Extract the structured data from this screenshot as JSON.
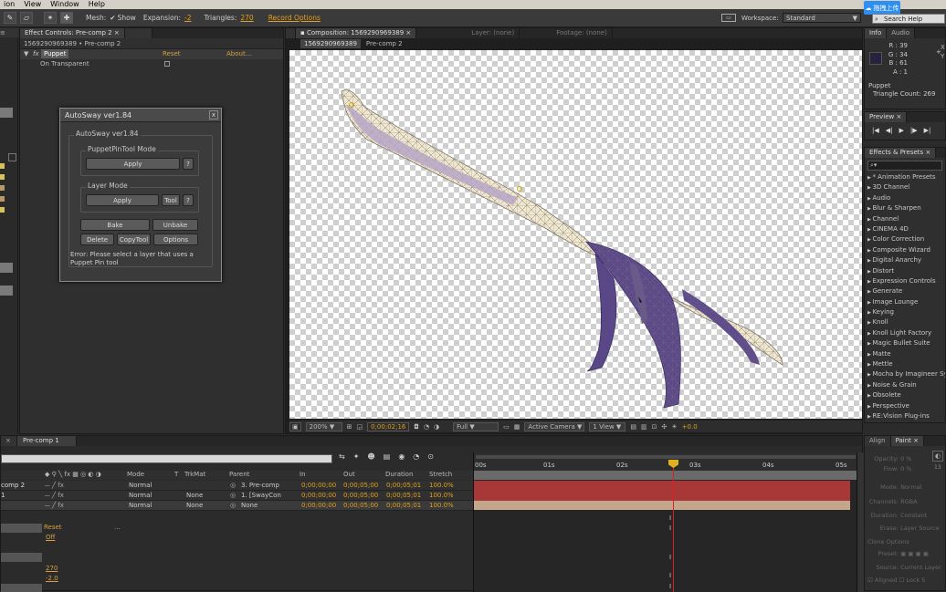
{
  "menubar": {
    "items": [
      "ion",
      "View",
      "Window",
      "Help"
    ]
  },
  "toolbar": {
    "mesh_label": "Mesh:",
    "show_label": "Show",
    "expansion_label": "Expansion:",
    "expansion_value": "-2",
    "triangles_label": "Triangles:",
    "triangles_value": "270",
    "record_options": "Record Options",
    "workspace_label": "Workspace:",
    "workspace_value": "Standard",
    "search_help": "Search Help",
    "cloud_label": "拖拽上传"
  },
  "effect_controls": {
    "tab": "Effect Controls: Pre-comp 2",
    "breadcrumb": "1569290969389 • Pre-comp 2",
    "effect_name": "Puppet",
    "reset": "Reset",
    "about": "About...",
    "on_transparent": "On Transparent"
  },
  "autosway": {
    "title": "AutoSway ver1.84",
    "group_label": "AutoSway ver1.84",
    "puppet_mode": "PuppetPinTool Mode",
    "apply": "Apply",
    "help": "?",
    "layer_mode": "Layer Mode",
    "layer_apply": "Apply",
    "tool": "Tool",
    "layer_help": "?",
    "bake": "Bake",
    "unbake": "Unbake",
    "delete": "Delete",
    "copytool": "CopyTool",
    "options": "Options",
    "error": "Error: Please select a layer that uses a Puppet Pin tool"
  },
  "composition": {
    "tab": "Composition: 1569290969389",
    "layer_tab": "Layer: (none)",
    "footage_tab": "Footage: (none)",
    "sub_tab1": "1569290969389",
    "sub_tab2": "Pre-comp 2"
  },
  "viewer_footer": {
    "zoom": "200%",
    "timecode": "0;00;02;16",
    "resolution": "Full",
    "camera": "Active Camera",
    "view": "1 View",
    "exposure": "+0.0"
  },
  "info": {
    "tab_info": "Info",
    "tab_audio": "Audio",
    "r": "R : 39",
    "g": "G : 34",
    "b": "B : 61",
    "a": "A : 1",
    "x": "X",
    "y": "Y",
    "layer": "Puppet",
    "triangle_count": "Triangle Count: 269"
  },
  "preview": {
    "tab": "Preview"
  },
  "effects_presets": {
    "tab": "Effects & Presets",
    "search_placeholder": "",
    "items": [
      "* Animation Presets",
      "3D Channel",
      "Audio",
      "Blur & Sharpen",
      "Channel",
      "CINEMA 4D",
      "Color Correction",
      "Composite Wizard",
      "Digital Anarchy",
      "Distort",
      "Expression Controls",
      "Generate",
      "Image Lounge",
      "Keying",
      "Knoll",
      "Knoll Light Factory",
      "Magic Bullet Suite",
      "Matte",
      "Mettle",
      "Mocha by Imagineer Sy",
      "Noise & Grain",
      "Obsolete",
      "Perspective",
      "RE:Vision Plug-ins"
    ]
  },
  "timeline": {
    "tab": "Pre-comp 1",
    "columns": {
      "mode": "Mode",
      "t": "T",
      "trkmat": "TrkMat",
      "parent": "Parent",
      "in": "In",
      "out": "Out",
      "duration": "Duration",
      "stretch": "Stretch"
    },
    "ruler": [
      "00s",
      "01s",
      "02s",
      "03s",
      "04s",
      "05s"
    ],
    "layers": [
      {
        "name": "comp 2",
        "mode": "Normal",
        "trkmat": "",
        "parent": "3. Pre-comp",
        "in": "0;00;00;00",
        "out": "0;00;05;00",
        "duration": "0;00;05;01",
        "stretch": "100.0%"
      },
      {
        "name": "1",
        "mode": "Normal",
        "trkmat": "None",
        "parent": "1. [SwayCon",
        "in": "0;00;00;00",
        "out": "0;00;05;00",
        "duration": "0;00;05;01",
        "stretch": "100.0%"
      },
      {
        "name": "",
        "mode": "Normal",
        "trkmat": "None",
        "parent": "None",
        "in": "0;00;00;00",
        "out": "0;00;05;00",
        "duration": "0;00;05;01",
        "stretch": "100.0%"
      }
    ],
    "props": {
      "reset": "Reset",
      "dots": "...",
      "off": "Off",
      "v270": "270",
      "vneg2": "-2.0"
    }
  },
  "align": {
    "tab": "Align"
  },
  "paint": {
    "tab": "Paint",
    "opacity": "Opacity:",
    "opacity_val": "0 %",
    "flow": "Flow:",
    "flow_val": "0 %",
    "mode": "Mode:",
    "mode_val": "Normal",
    "channels": "Channels:",
    "channels_val": "RGBA",
    "duration": "Duration:",
    "duration_val": "Constant",
    "erase": "Erase:",
    "erase_val": "Layer Source",
    "clone_options": "Clone Options",
    "preset": "Preset:",
    "source": "Source:",
    "source_val": "Current Layer",
    "aligned": "Aligned",
    "lock": "Lock S",
    "num13": "13"
  },
  "colors": {
    "accent": "#e0a020",
    "layer_red": "#a83737",
    "layer_tan": "#c4a78a",
    "playhead": "#e02020",
    "swatch": "#27223d"
  }
}
